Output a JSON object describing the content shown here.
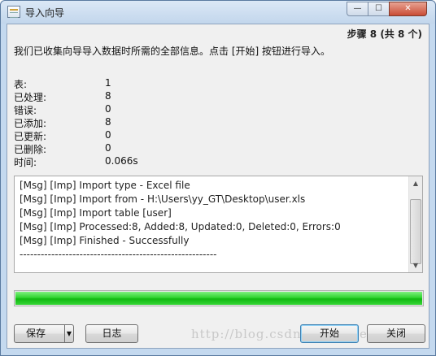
{
  "window": {
    "title": "导入向导",
    "icon": "import-wizard-icon"
  },
  "title_buttons": {
    "minimize": "—",
    "maximize": "☐",
    "close": "✕"
  },
  "step_label": "步骤 8 (共 8 个)",
  "intro_text": "我们已收集向导导入数据时所需的全部信息。点击 [开始] 按钮进行导入。",
  "stats": [
    {
      "label": "表:",
      "value": "1"
    },
    {
      "label": "已处理:",
      "value": "8"
    },
    {
      "label": "错误:",
      "value": "0"
    },
    {
      "label": "已添加:",
      "value": "8"
    },
    {
      "label": "已更新:",
      "value": "0"
    },
    {
      "label": "已删除:",
      "value": "0"
    },
    {
      "label": "时间:",
      "value": "0.066s"
    }
  ],
  "log_lines": [
    "[Msg] [Imp] Import type - Excel file",
    "[Msg] [Imp] Import from - H:\\Users\\yy_GT\\Desktop\\user.xls",
    "[Msg] [Imp] Import table [user]",
    "[Msg] [Imp] Processed:8, Added:8, Updated:0, Deleted:0, Errors:0",
    "[Msg] [Imp] Finished - Successfully",
    "--------------------------------------------------------"
  ],
  "progress": {
    "fraction": 1.0
  },
  "buttons": {
    "save": "保存",
    "save_dropdown": "▼",
    "log": "日志",
    "start": "开始",
    "close": "关闭"
  },
  "watermark": "http://blog.csdn.net/yyDeng"
}
